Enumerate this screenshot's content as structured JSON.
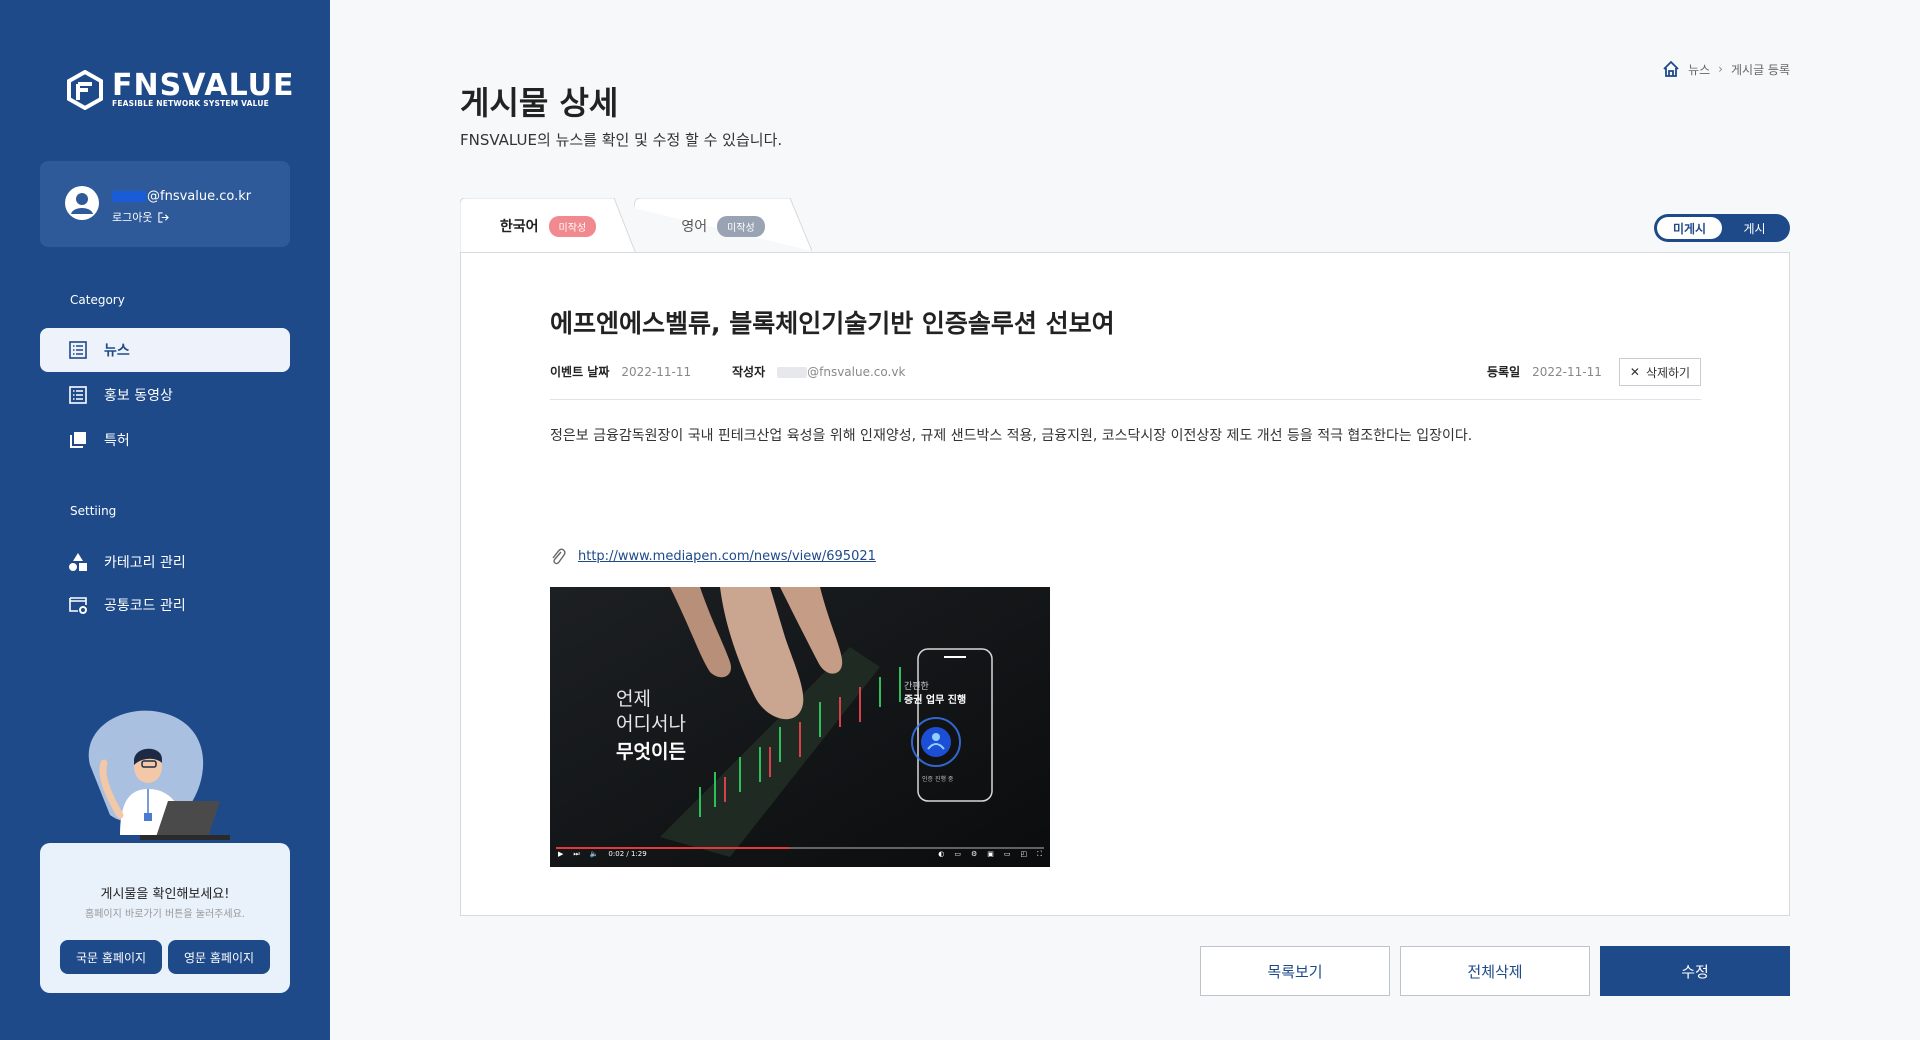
{
  "sidebar": {
    "logo_text": "FNSVALUE",
    "logo_sub": "FEASIBLE NETWORK SYSTEM VALUE",
    "user": {
      "email": "@fnsvalue.co.kr",
      "logout_label": "로그아웃"
    },
    "category_label": "Category",
    "category_items": [
      {
        "label": "뉴스",
        "icon": "list-icon",
        "active": true
      },
      {
        "label": "홍보 동영상",
        "icon": "list-icon",
        "active": false
      },
      {
        "label": "특허",
        "icon": "copy-icon",
        "active": false
      }
    ],
    "setting_label": "Settiing",
    "setting_items": [
      {
        "label": "카테고리 관리",
        "icon": "shapes-icon"
      },
      {
        "label": "공통코드 관리",
        "icon": "gear-window-icon"
      }
    ],
    "promo": {
      "title": "게시물을 확인해보세요!",
      "subtitle": "홈페이지 바로가기 버튼을 눌러주세요.",
      "btn_kr": "국문 홈페이지",
      "btn_en": "영문 홈페이지"
    }
  },
  "breadcrumb": {
    "home_icon": "home-icon",
    "items": [
      "뉴스",
      "게시글 등록"
    ]
  },
  "page": {
    "title": "게시물 상세",
    "description": "FNSVALUE의 뉴스를 확인 및 수정 할 수 있습니다."
  },
  "tabs": [
    {
      "label": "한국어",
      "badge": "미작성",
      "badge_color": "#f08a8f",
      "active": true
    },
    {
      "label": "영어",
      "badge": "미작성",
      "badge_color": "#9aa3b3",
      "active": false
    }
  ],
  "toggle": {
    "off_label": "미게시",
    "on_label": "게시",
    "selected": "미게시"
  },
  "article": {
    "title": "에프엔에스벨류, 블록체인기술기반 인증솔루션 선보여",
    "event_date_label": "이벤트 날짜",
    "event_date": "2022-11-11",
    "author_label": "작성자",
    "author": "@fnsvalue.co.vk",
    "reg_date_label": "등록일",
    "reg_date": "2022-11-11",
    "delete_label": "삭제하기",
    "body": "정은보 금융감독원장이 국내 핀테크산업 육성을 위해 인재양성, 규제 샌드박스 적용, 금융지원, 코스닥시장 이전상장 제도 개선 등을 적극 협조한다는 입장이다.",
    "link": "http://www.mediapen.com/news/view/695021",
    "video": {
      "text_line1": "언제",
      "text_line2": "어디서나",
      "text_line3": "무엇이든",
      "card_caption": "간편한",
      "card_title": "증권 업무 진행",
      "card_small": "인증 진행 중",
      "time": "0:02 / 1:29",
      "progress": 0.48
    }
  },
  "actions": {
    "list": "목록보기",
    "delete_all": "전체삭제",
    "edit": "수정"
  },
  "colors": {
    "brand": "#1e4a8a",
    "badge_red": "#f08a8f",
    "badge_gray": "#9aa3b3"
  }
}
